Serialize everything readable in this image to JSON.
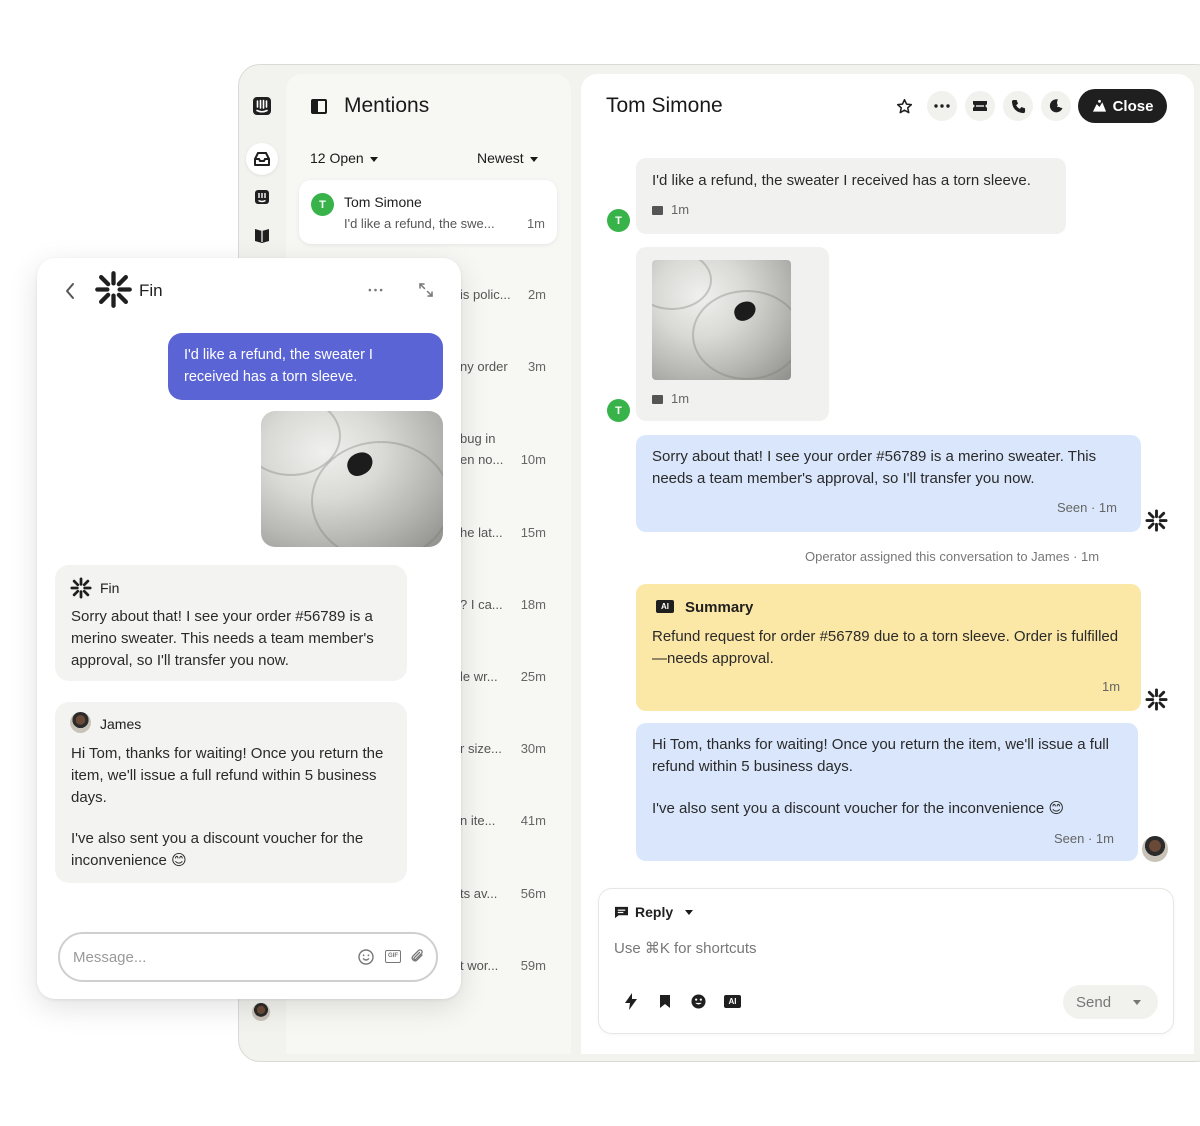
{
  "mentions": {
    "title": "Mentions",
    "filter_open": "12 Open",
    "sort": "Newest",
    "selected": {
      "avatar": "T",
      "name": "Tom Simone",
      "preview": "I'd like a refund, the swe...",
      "time": "1m"
    },
    "rows": [
      {
        "preview": "is polic...",
        "time": "2m"
      },
      {
        "preview": "ny order",
        "time": "3m"
      },
      {
        "preview_line1": "bug in",
        "preview": "en no...",
        "time": "10m"
      },
      {
        "preview": "he lat...",
        "time": "15m"
      },
      {
        "preview": "? I ca...",
        "time": "18m"
      },
      {
        "preview": "le wr...",
        "time": "25m"
      },
      {
        "preview": "r size...",
        "time": "30m"
      },
      {
        "preview": "n ite...",
        "time": "41m"
      },
      {
        "preview": "ts av...",
        "time": "56m"
      },
      {
        "preview": "t wor...",
        "time": "59m"
      }
    ]
  },
  "conversation": {
    "title": "Tom Simone",
    "close_label": "Close",
    "customer_avatar": "T",
    "msg1": {
      "text": "I'd like a refund, the sweater I received has a torn sleeve.",
      "time": "1m"
    },
    "msg2": {
      "time": "1m"
    },
    "msg3": {
      "text": "Sorry about that! I see your order #56789 is a merino sweater. This needs a team member's approval, so I'll transfer you now.",
      "status": "Seen · 1m"
    },
    "assignment": "Operator assigned this conversation to James · 1m",
    "summary": {
      "badge": "AI",
      "title": "Summary",
      "text": "Refund request for order #56789 due to a torn sleeve. Order is fulfilled—needs approval.",
      "time": "1m"
    },
    "msg4": {
      "text1": "Hi Tom, thanks for waiting! Once you return the item, we'll issue a full refund within 5 business days.",
      "text2": "I've also sent you a discount voucher for the inconvenience 😊",
      "status": "Seen · 1m"
    },
    "composer": {
      "mode": "Reply",
      "placeholder": "Use ⌘K for shortcuts",
      "send": "Send",
      "ai_badge": "AI"
    }
  },
  "widget": {
    "bot_name": "Fin",
    "user_msg": "I'd like a refund, the sweater I received has a torn sleeve.",
    "fin_msg": {
      "name": "Fin",
      "text": "Sorry about that! I see your order #56789 is a merino sweater. This needs a team member's approval, so I'll transfer you now."
    },
    "james_msg": {
      "name": "James",
      "text1": "Hi Tom, thanks for waiting! Once you return the item, we'll issue a full refund within 5 business days.",
      "text2": "I've also sent you a discount voucher for the inconvenience 😊"
    },
    "input_placeholder": "Message...",
    "gif_label": "GIF"
  },
  "colors": {
    "accent": "#5b64d4",
    "customer_avatar": "#37b34a",
    "blue_bubble": "#d9e6fb",
    "summary": "#fbe7a6",
    "dark": "#1f1f1f"
  },
  "icons": [
    "inbox-icon",
    "intercom-logo-icon",
    "contacts-icon",
    "knowledge-icon",
    "star-icon",
    "more-icon",
    "ticket-icon",
    "phone-icon",
    "snooze-icon",
    "fin-logo-icon",
    "lightning-icon",
    "bookmark-icon",
    "emoji-icon",
    "attach-icon"
  ]
}
